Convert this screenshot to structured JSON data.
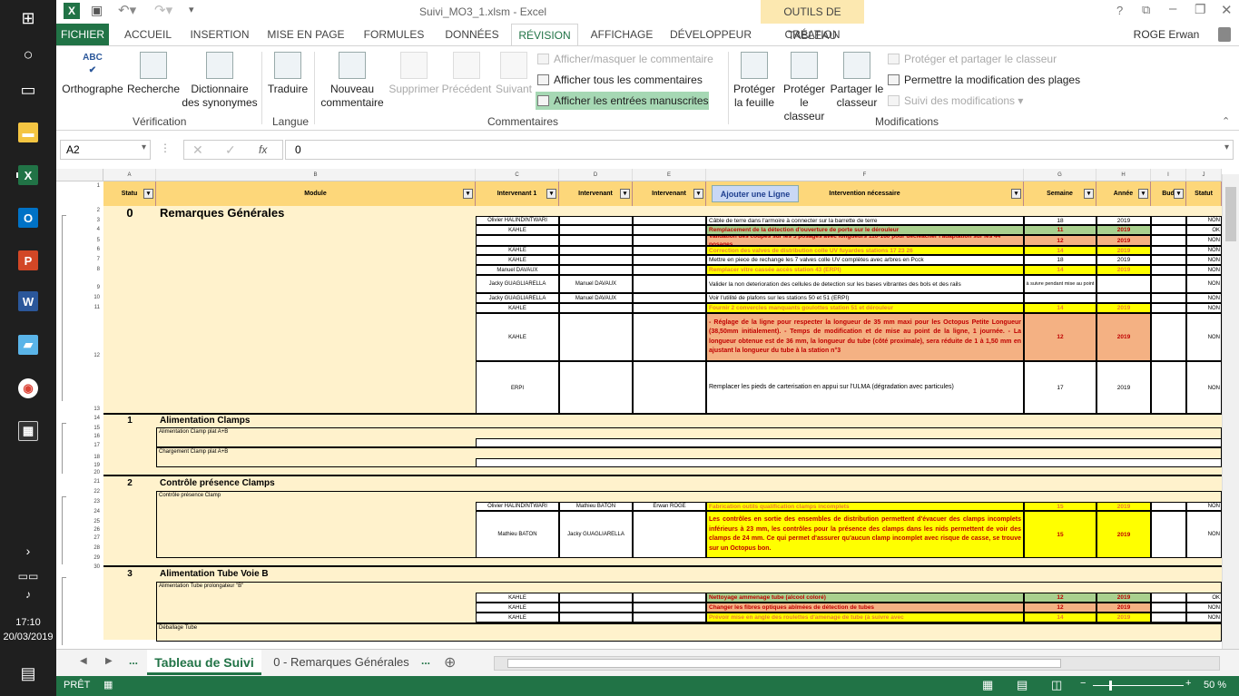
{
  "window": {
    "title": "Suivi_MO3_1.xlsm - Excel",
    "tools_label": "OUTILS DE TABLEAU",
    "user": "ROGE Erwan"
  },
  "tabs": [
    "FICHIER",
    "ACCUEIL",
    "INSERTION",
    "MISE EN PAGE",
    "FORMULES",
    "DONNÉES",
    "RÉVISION",
    "AFFICHAGE",
    "DÉVELOPPEUR",
    "CRÉATION"
  ],
  "ribbon": {
    "orthographe": "Orthographe",
    "recherche": "Recherche",
    "dictionnaire": "Dictionnaire des synonymes",
    "traduire": "Traduire",
    "nouveau_commentaire": "Nouveau commentaire",
    "supprimer": "Supprimer",
    "precedent": "Précédent",
    "suivant": "Suivant",
    "afficher_masquer": "Afficher/masquer le commentaire",
    "afficher_tous": "Afficher tous les commentaires",
    "afficher_manuscrites": "Afficher les entrées manuscrites",
    "proteger_feuille": "Protéger la feuille",
    "proteger_classeur": "Protéger le classeur",
    "partager_classeur": "Partager le classeur",
    "proteger_partager": "Protéger et partager le classeur",
    "permettre_modif": "Permettre la modification des plages",
    "suivi_modifs": "Suivi des modifications",
    "groups": {
      "verification": "Vérification",
      "langue": "Langue",
      "commentaires": "Commentaires",
      "modifications": "Modifications"
    }
  },
  "formula": {
    "namebox": "A2",
    "value": "0",
    "fx": "fx"
  },
  "columns": [
    "A",
    "B",
    "C",
    "D",
    "E",
    "F",
    "G",
    "H",
    "I",
    "J"
  ],
  "headers": {
    "statut": "Statu",
    "module": "Module",
    "intervenant1": "Intervenant 1",
    "intervenant2": "Intervenant",
    "intervenant3": "Intervenant",
    "ajouter": "Ajouter une Ligne",
    "intervention": "Intervention nécessaire",
    "semaine": "Semaine",
    "annee": "Année",
    "bud": "Bud",
    "statut2": "Statut"
  },
  "sections": [
    {
      "num": "0",
      "title": "Remarques Générales"
    },
    {
      "num": "1",
      "title": "Alimentation Clamps",
      "sub1": "Alimentation Clamp plat A+B",
      "sub2": "Chargement Clamp plat A+B"
    },
    {
      "num": "2",
      "title": "Contrôle présence Clamps",
      "sub1": "Contrôle présence Clamp"
    },
    {
      "num": "3",
      "title": "Alimentation Tube Voie B",
      "sub1": "Alimentation Tube prolongateur \"B\"",
      "sub2": "Déballage Tube"
    }
  ],
  "rows0": [
    {
      "r": "3",
      "c1": "Olivier HALINDINTWARI",
      "f": "Câble de terre dans l'armoire à connecter sur la barrette de terre",
      "g": "18",
      "h": "2019",
      "j": "NON"
    },
    {
      "r": "4",
      "c1": "KAHLE",
      "f": "Remplacement de la détection d'ouverture de porte sur le dérouleur",
      "g": "11",
      "h": "2019",
      "j": "OK"
    },
    {
      "r": "5",
      "c1": "",
      "f": "Validation des coupes sur les 5 posages avec longueurs 110-160 pour décleacher l'adaptation sur les 44 posages",
      "g": "12",
      "h": "2019",
      "j": "NON"
    },
    {
      "r": "6",
      "c1": "KAHLE",
      "f": "Correction des valves de distribution colle UV fuyardes stations 17 23 26",
      "g": "14",
      "h": "2019",
      "j": "NON"
    },
    {
      "r": "7",
      "c1": "KAHLE",
      "f": "Mettre en piece de rechange les 7 valves colle UV complètes avec arbres en Pcck",
      "g": "18",
      "h": "2019",
      "j": "NON"
    },
    {
      "r": "8",
      "c1": "Manuel DAVAUX",
      "f": "Remplacer vitre cassée accès station 43 (ERPI)",
      "g": "14",
      "h": "2019",
      "j": "NON"
    },
    {
      "r": "9",
      "c1": "Jacky GUAGLIARELLA",
      "c2": "Manuel DAVAUX",
      "f": "Valider la non deterioration des cellules de detection sur les bases vibrantes des bols et des rails",
      "g": "à suivre pendant mise au point",
      "h": "",
      "j": "NON"
    },
    {
      "r": "10",
      "c1": "Jacky GUAGLIARELLA",
      "c2": "Manuel DAVAUX",
      "f": "Voir l'utilité de plafons sur les stations 50 et 51 (ERPI)",
      "g": "",
      "h": "",
      "j": "NON"
    },
    {
      "r": "11",
      "c1": "KAHLE",
      "f": "Fournir 2 convercles manquants goulottes station 51 et dérouleur",
      "g": "14",
      "h": "2019",
      "j": "NON"
    },
    {
      "r": "12",
      "c1": "KAHLE",
      "f": "- Réglage de la ligne pour respecter la longueur de 35 mm maxi pour les Octopus Petite Longueur (38,50mm initialement). - Temps de modification et de mise au point de la ligne, 1 journée. - La longueur obtenue est de 36 mm, la longueur du tube (côté proximale), sera réduite de 1 à 1,50 mm en ajustant la longueur du tube à la station n°3",
      "g": "12",
      "h": "2019",
      "j": "NON"
    },
    {
      "r": "13",
      "c1": "ERPI",
      "f": "Remplacer les pieds de carterisation en appui sur l'ULMA (dégradation avec particules)",
      "g": "17",
      "h": "2019",
      "j": "NON"
    }
  ],
  "rows2": [
    {
      "r": "22",
      "c1": "Olivier HALINDINTWARI",
      "c2": "Mathieu BATON",
      "c3": "Erwan ROGE",
      "f": "Fabrication outils qualification clamps incomplets",
      "g": "15",
      "h": "2019",
      "j": "NON"
    },
    {
      "r": "23",
      "c1": "Mathieu BATON",
      "c2": "Jacky GUAGLIARELLA",
      "f": "Les contrôles en sortie des ensembles de distribution permettent d'évacuer des clamps incomplets inférieurs à 23 mm, les contrôles pour la présence des clamps dans les nids permettent de voir des clamps de 24 mm. Ce qui permet d'assurer qu'aucun clamp incomplet avec risque de casse, se trouve sur un Octopus bon.",
      "g": "15",
      "h": "2019",
      "j": "NON"
    }
  ],
  "rows3": [
    {
      "r": "27",
      "c1": "KAHLE",
      "f": "Nettoyage ammenage tube (alcool coloré)",
      "g": "12",
      "h": "2019",
      "j": "OK"
    },
    {
      "r": "28",
      "c1": "KAHLE",
      "f": "Changer les fibres optiques abîmées de détection de tubes",
      "g": "12",
      "h": "2019",
      "j": "NON"
    },
    {
      "r": "29",
      "c1": "KAHLE",
      "f": "Prévoir mise en angle des roulettes d'amenage de tube (à suivre avec",
      "g": "14",
      "h": "2019",
      "j": "NON"
    }
  ],
  "rownums": [
    "1",
    "2",
    "3",
    "4",
    "5",
    "6",
    "7",
    "8",
    "9",
    "10",
    "11",
    "12",
    "13",
    "14",
    "15",
    "16",
    "17",
    "18",
    "19",
    "20",
    "21",
    "22",
    "23",
    "24",
    "25",
    "26",
    "27",
    "28",
    "29",
    "30"
  ],
  "sheettabs": {
    "active": "Tableau de Suivi",
    "other": "0 - Remarques Générales",
    "more": "..."
  },
  "status": {
    "ready": "PRÊT",
    "zoom": "50 %"
  },
  "clock": {
    "time": "17:10",
    "date": "20/03/2019"
  }
}
